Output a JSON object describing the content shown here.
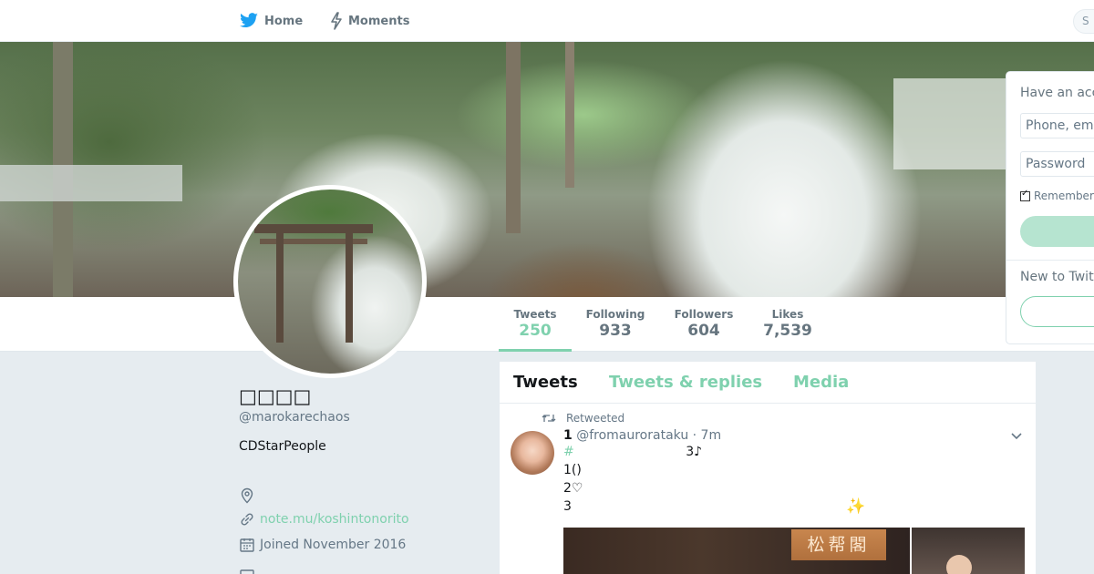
{
  "nav": {
    "home_label": "Home",
    "moments_label": "Moments",
    "search_placeholder": "S",
    "brand_color": "#1da1f2",
    "accent_color": "#7fd1ae"
  },
  "profile": {
    "name": "□□□□",
    "handle": "@marokarechaos",
    "bio": "CDStarPeople",
    "website": "note.mu/koshintonorito",
    "joined": "Joined November 2016"
  },
  "stats": [
    {
      "label": "Tweets",
      "value": "250"
    },
    {
      "label": "Following",
      "value": "933"
    },
    {
      "label": "Followers",
      "value": "604"
    },
    {
      "label": "Likes",
      "value": "7,539"
    }
  ],
  "timeline": {
    "tabs": [
      "Tweets",
      "Tweets & replies",
      "Media"
    ],
    "tweet": {
      "retweet_label": "Retweeted",
      "author_name": "1",
      "author_handle": "@fromaurorataku",
      "time": "· 7m",
      "hashtag": "#",
      "line1_tail": "3♪",
      "line2": "1()",
      "line3": "2♡",
      "line4": "3",
      "sparkle": "✨",
      "media_sign": "松帮閣"
    }
  },
  "login": {
    "title": "Have an account?",
    "phone_placeholder": "Phone, email",
    "password_placeholder": "Password",
    "remember_label": "Remember me",
    "signup_title": "New to Twitter?"
  }
}
